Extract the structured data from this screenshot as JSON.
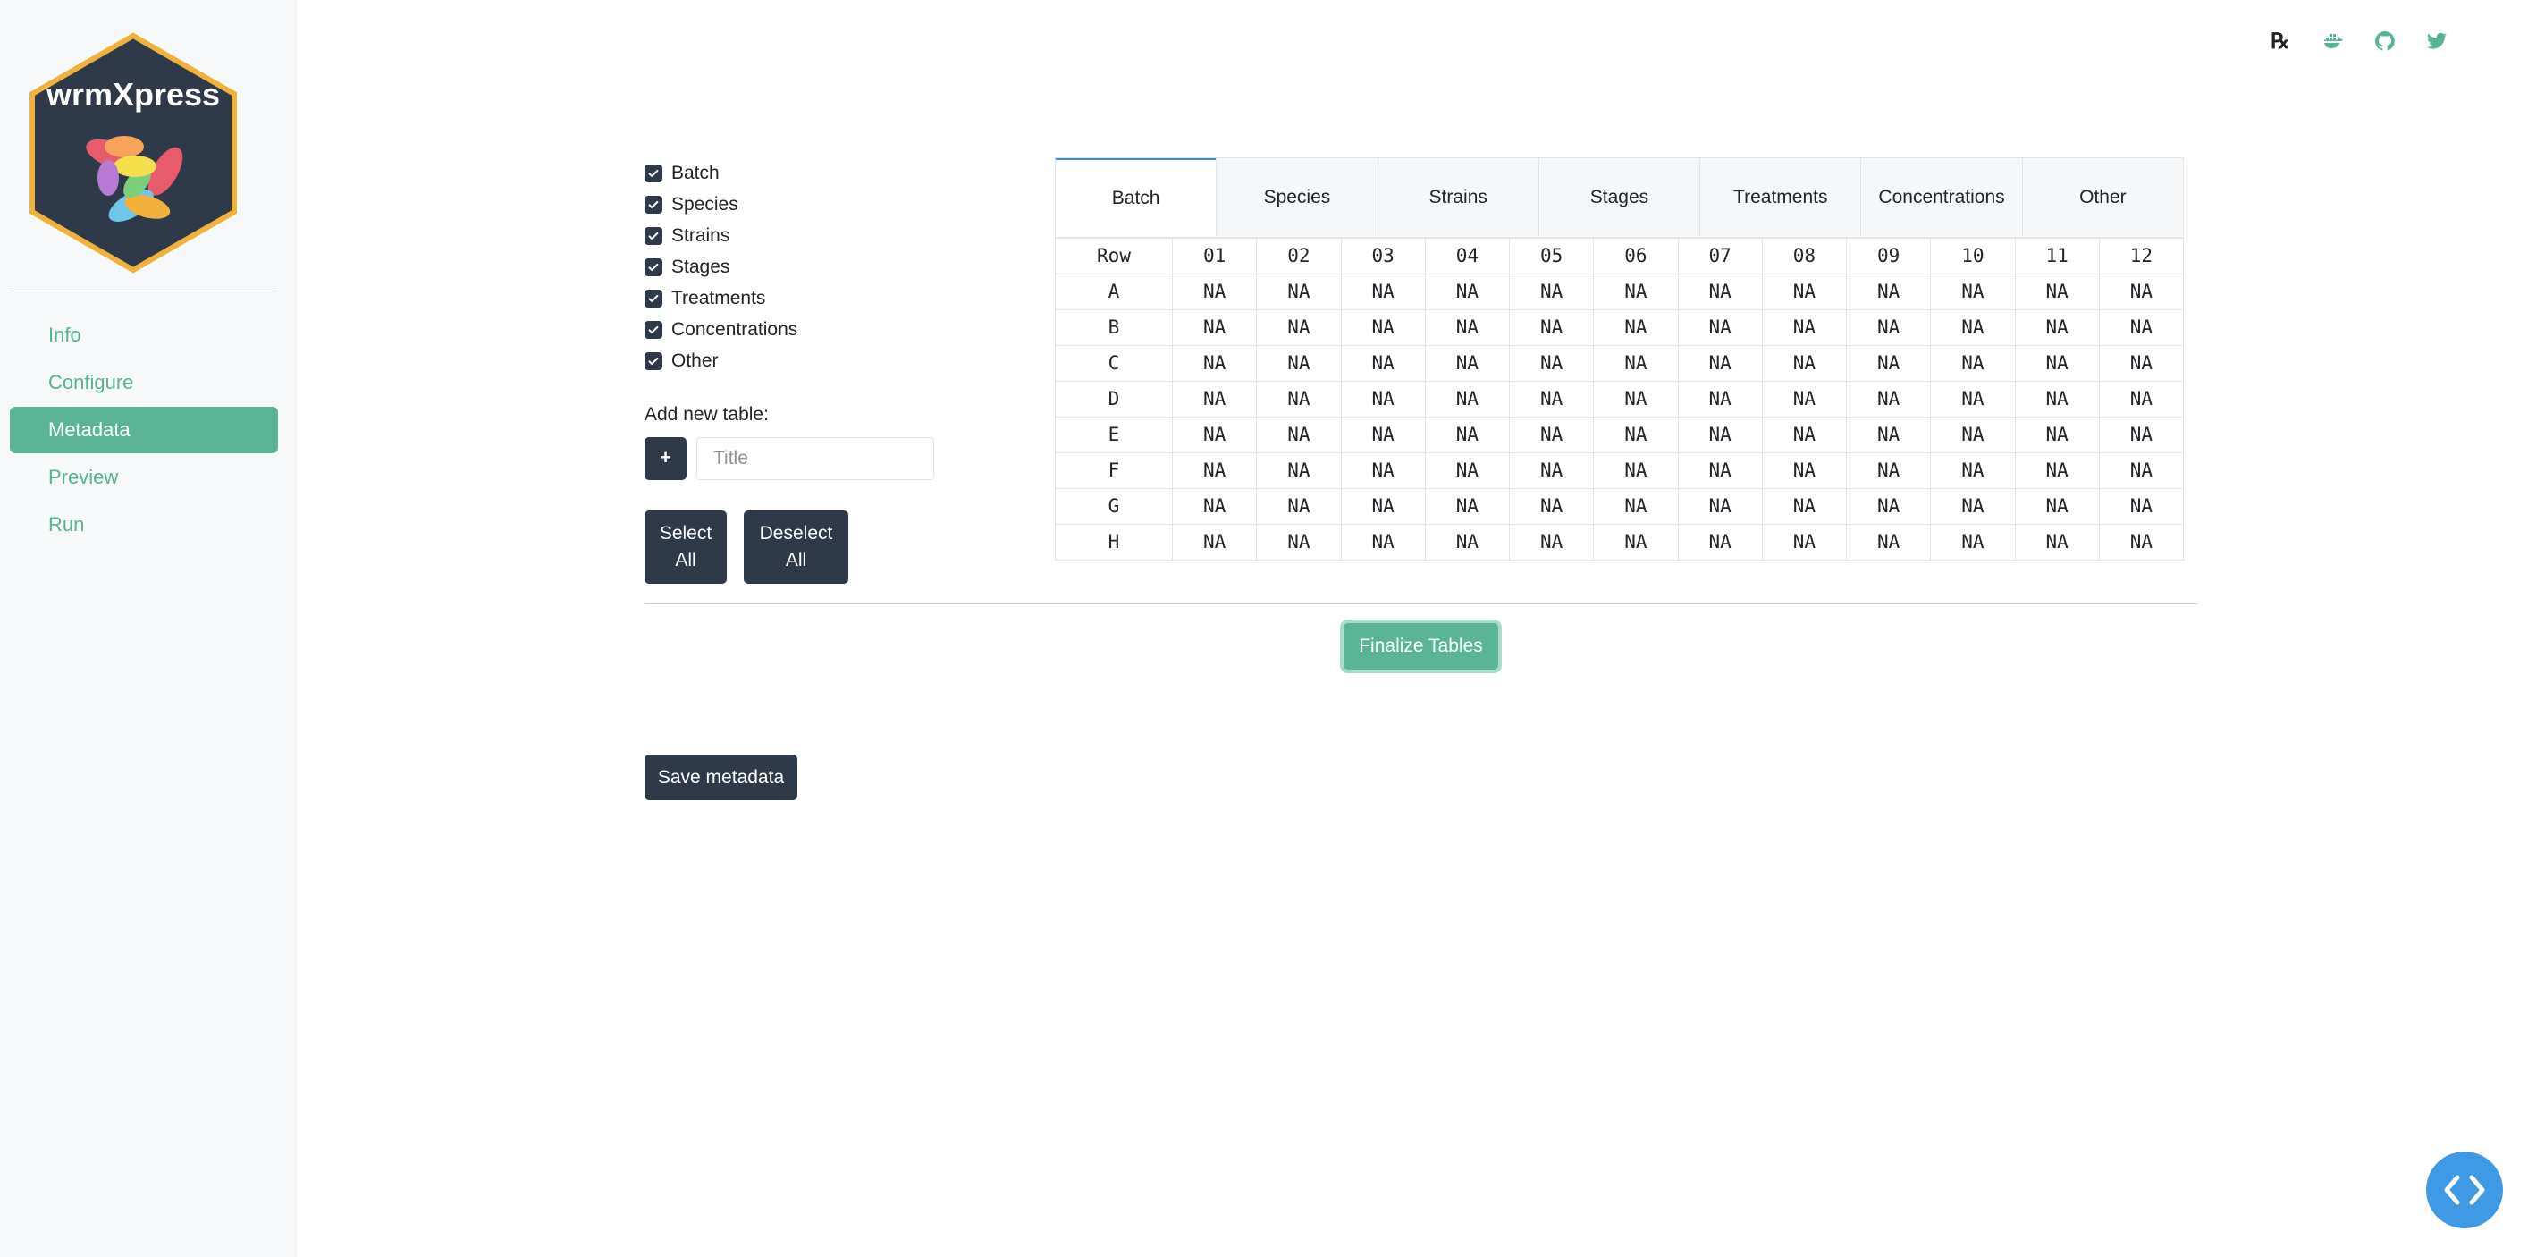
{
  "app": {
    "logo_text": "wrmXpress"
  },
  "sidebar": {
    "items": [
      {
        "label": "Info",
        "active": false
      },
      {
        "label": "Configure",
        "active": false
      },
      {
        "label": "Metadata",
        "active": true
      },
      {
        "label": "Preview",
        "active": false
      },
      {
        "label": "Run",
        "active": false
      }
    ]
  },
  "header_icons": [
    "prescription-icon",
    "docker-icon",
    "github-icon",
    "twitter-icon"
  ],
  "checklist": {
    "items": [
      {
        "label": "Batch",
        "checked": true
      },
      {
        "label": "Species",
        "checked": true
      },
      {
        "label": "Strains",
        "checked": true
      },
      {
        "label": "Stages",
        "checked": true
      },
      {
        "label": "Treatments",
        "checked": true
      },
      {
        "label": "Concentrations",
        "checked": true
      },
      {
        "label": "Other",
        "checked": true
      }
    ]
  },
  "add_table": {
    "label": "Add new table:",
    "plus_label": "+",
    "placeholder": "Title",
    "value": ""
  },
  "buttons": {
    "select_all": "Select All",
    "deselect_all": "Deselect All",
    "finalize": "Finalize Tables",
    "save": "Save metadata"
  },
  "tabs": [
    {
      "label": "Batch",
      "active": true
    },
    {
      "label": "Species",
      "active": false
    },
    {
      "label": "Strains",
      "active": false
    },
    {
      "label": "Stages",
      "active": false
    },
    {
      "label": "Treatments",
      "active": false
    },
    {
      "label": "Concentrations",
      "active": false
    },
    {
      "label": "Other",
      "active": false
    }
  ],
  "table": {
    "row_header": "Row",
    "columns": [
      "01",
      "02",
      "03",
      "04",
      "05",
      "06",
      "07",
      "08",
      "09",
      "10",
      "11",
      "12"
    ],
    "rows": [
      "A",
      "B",
      "C",
      "D",
      "E",
      "F",
      "G",
      "H"
    ],
    "cell_value": "NA"
  },
  "colors": {
    "accent": "#5ab596",
    "dark": "#2e3a4a",
    "fab": "#3f9ae6",
    "active_tab_border": "#3a8bd8"
  }
}
